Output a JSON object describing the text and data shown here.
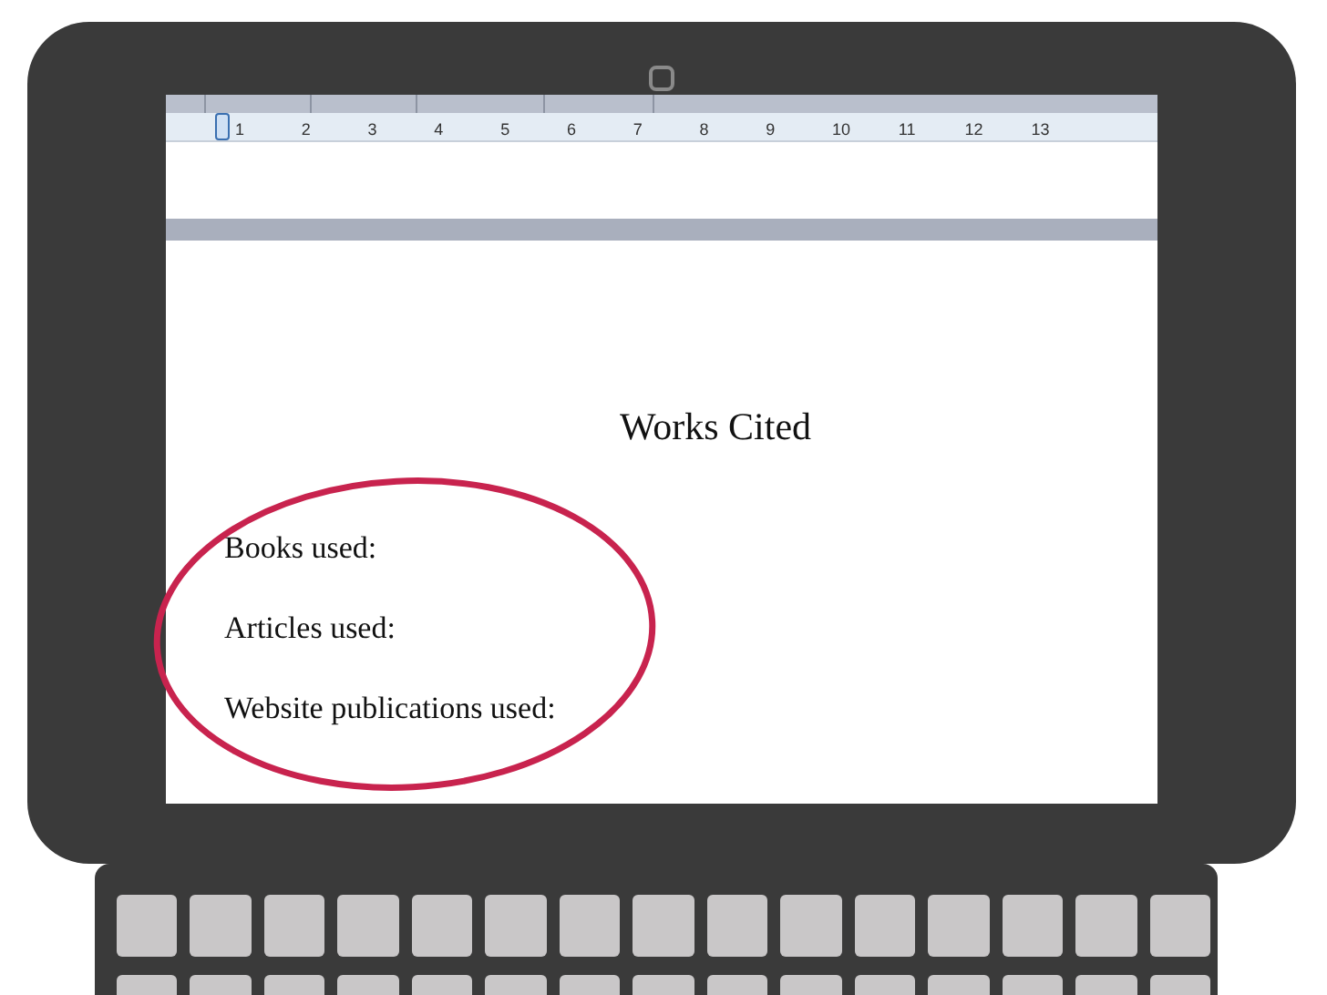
{
  "ruler": {
    "numbers": [
      "1",
      "2",
      "3",
      "4",
      "5",
      "6",
      "7",
      "8",
      "9",
      "10",
      "11",
      "12",
      "13"
    ]
  },
  "document": {
    "heading": "Works Cited",
    "lines": [
      "Books used:",
      "Articles used:",
      "Website publications used:"
    ]
  }
}
